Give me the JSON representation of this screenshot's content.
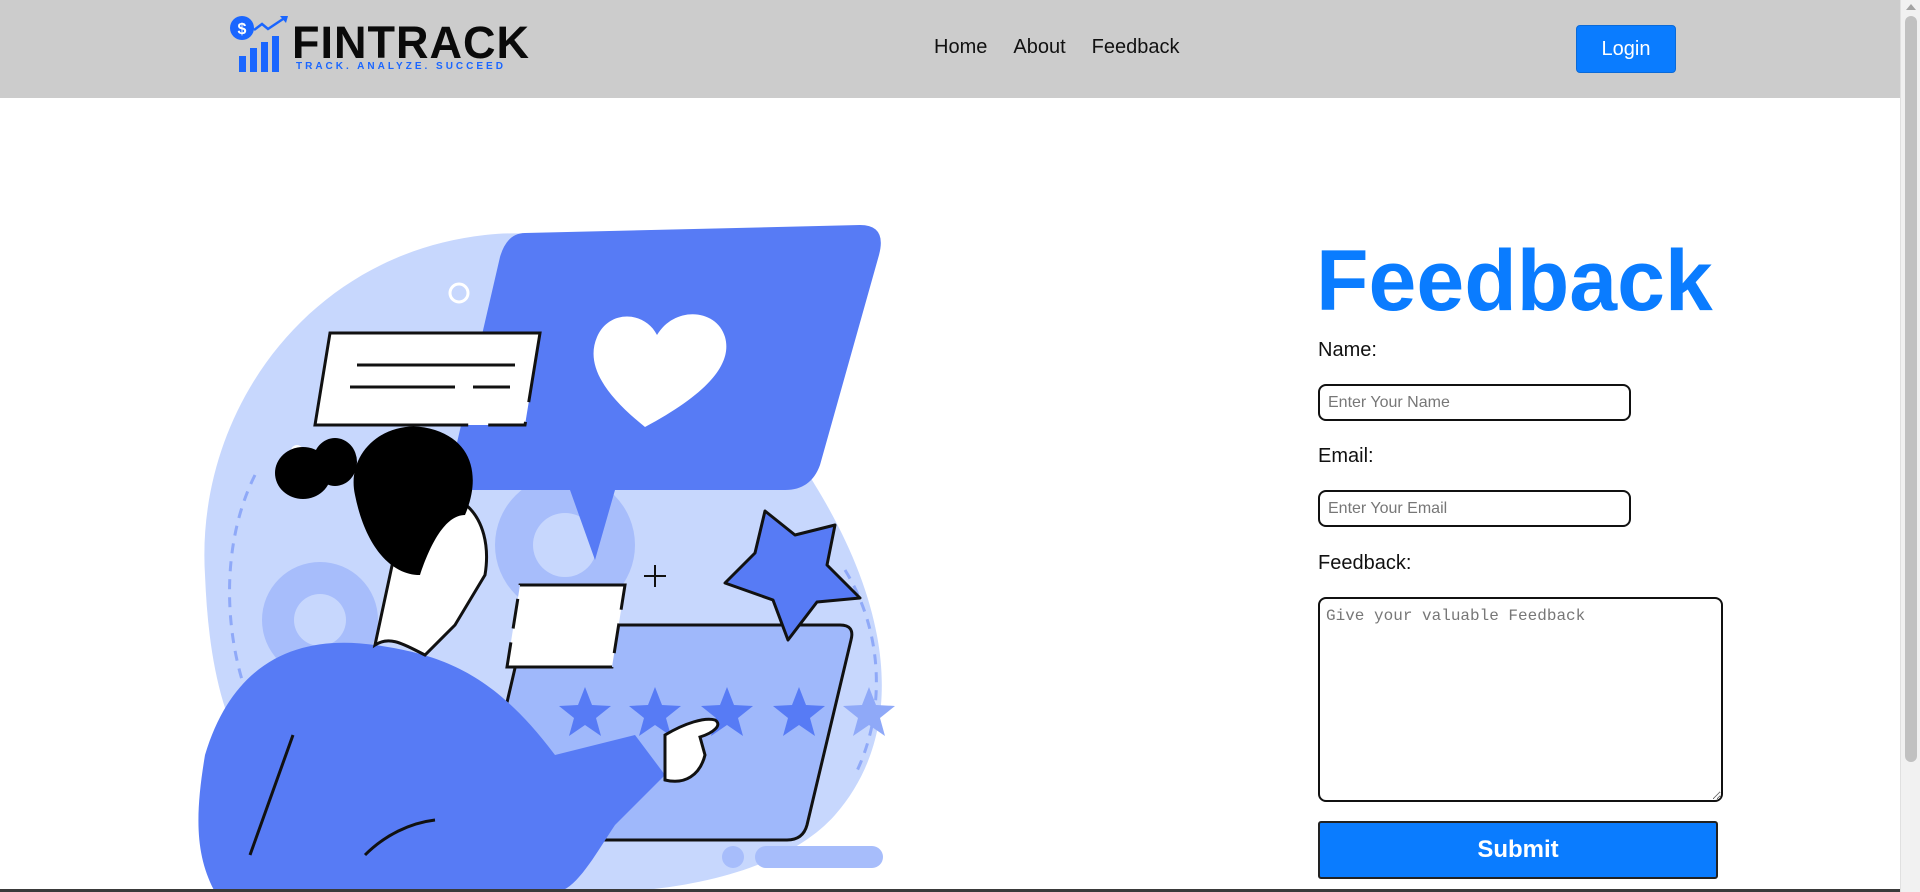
{
  "logo": {
    "name": "FINTRACK",
    "tagline": "TRACK. ANALYZE. SUCCEED"
  },
  "nav": {
    "items": [
      "Home",
      "About",
      "Feedback"
    ]
  },
  "header": {
    "login_label": "Login"
  },
  "form": {
    "title": "Feedback",
    "name_label": "Name:",
    "name_placeholder": "Enter Your Name",
    "email_label": "Email:",
    "email_placeholder": "Enter Your Email",
    "feedback_label": "Feedback:",
    "feedback_placeholder": "Give your valuable Feedback",
    "submit_label": "Submit"
  },
  "colors": {
    "accent": "#0a7cff",
    "navbar_bg": "#cccccc",
    "illustration_primary": "#577bf5",
    "illustration_light": "#c7d7fd"
  },
  "icons": [
    "dollar-icon",
    "trend-arrow-icon",
    "heart-icon",
    "star-icon",
    "chat-bubble-icon"
  ]
}
